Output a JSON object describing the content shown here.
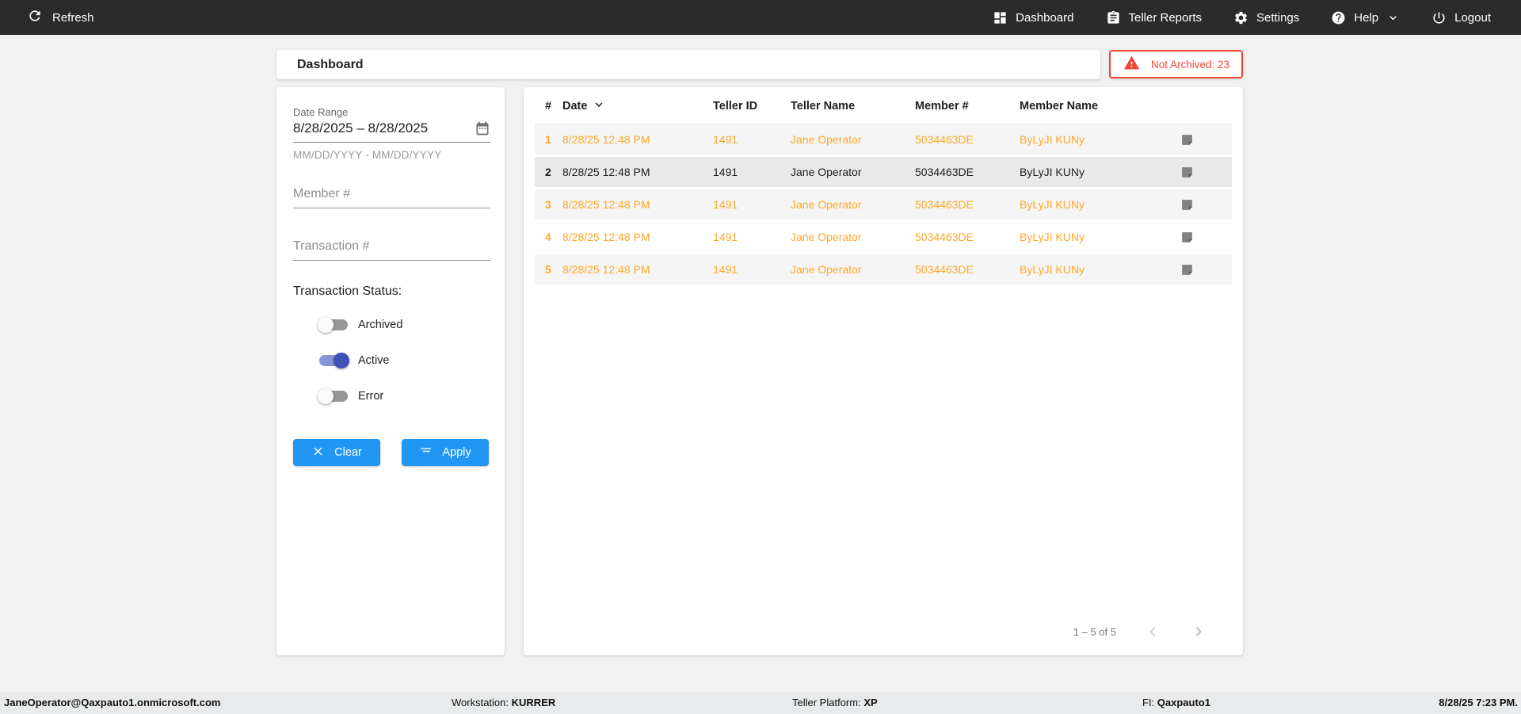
{
  "colors": {
    "navbar_bg": "#2b2b2b",
    "accent_blue": "#2196f3",
    "row_orange": "#ffa726",
    "alert_red": "#f44336",
    "toggle_indigo": "#3f51b5"
  },
  "navbar": {
    "refresh_label": "Refresh",
    "items": [
      {
        "label": "Dashboard",
        "icon": "dashboard-icon"
      },
      {
        "label": "Teller Reports",
        "icon": "clipboard-icon"
      },
      {
        "label": "Settings",
        "icon": "gear-icon"
      },
      {
        "label": "Help",
        "icon": "help-icon",
        "has_dropdown": true
      },
      {
        "label": "Logout",
        "icon": "power-icon"
      }
    ]
  },
  "header": {
    "title": "Dashboard",
    "alert_label": "Not Archived: 23"
  },
  "filters": {
    "date_range_label": "Date Range",
    "date_range_value": "8/28/2025 – 8/28/2025",
    "date_range_hint": "MM/DD/YYYY - MM/DD/YYYY",
    "member_placeholder": "Member #",
    "transaction_placeholder": "Transaction #",
    "status_label": "Transaction Status:",
    "toggles": [
      {
        "label": "Archived",
        "on": false
      },
      {
        "label": "Active",
        "on": true
      },
      {
        "label": "Error",
        "on": false
      }
    ],
    "clear_label": "Clear",
    "apply_label": "Apply"
  },
  "table": {
    "columns": {
      "num": "#",
      "date": "Date",
      "teller_id": "Teller ID",
      "teller_name": "Teller Name",
      "member_num": "Member #",
      "member_name": "Member Name"
    },
    "sort_column": "Date",
    "rows": [
      {
        "num": "1",
        "date": "8/28/25 12:48 PM",
        "teller_id": "1491",
        "teller_name": "Jane Operator",
        "member_num": "5034463DE",
        "member_name": "ByLyJI KUNy",
        "highlight": true,
        "shade": "light"
      },
      {
        "num": "2",
        "date": "8/28/25 12:48 PM",
        "teller_id": "1491",
        "teller_name": "Jane Operator",
        "member_num": "5034463DE",
        "member_name": "ByLyJI KUNy",
        "highlight": false,
        "shade": "dark"
      },
      {
        "num": "3",
        "date": "8/28/25 12:48 PM",
        "teller_id": "1491",
        "teller_name": "Jane Operator",
        "member_num": "5034463DE",
        "member_name": "ByLyJI KUNy",
        "highlight": true,
        "shade": "light"
      },
      {
        "num": "4",
        "date": "8/28/25 12:48 PM",
        "teller_id": "1491",
        "teller_name": "Jane Operator",
        "member_num": "5034463DE",
        "member_name": "ByLyJI KUNy",
        "highlight": true,
        "shade": "white"
      },
      {
        "num": "5",
        "date": "8/28/25 12:48 PM",
        "teller_id": "1491",
        "teller_name": "Jane Operator",
        "member_num": "5034463DE",
        "member_name": "ByLyJI KUNy",
        "highlight": true,
        "shade": "light"
      }
    ],
    "pagination": {
      "range_label": "1 – 5 of 5"
    }
  },
  "footer": {
    "user": "JaneOperator@Qaxpauto1.onmicrosoft.com",
    "workstation_label": "Workstation:",
    "workstation_value": "KURRER",
    "platform_label": "Teller Platform:",
    "platform_value": "XP",
    "fi_label": "FI:",
    "fi_value": "Qaxpauto1",
    "datetime": "8/28/25 7:23 PM."
  }
}
